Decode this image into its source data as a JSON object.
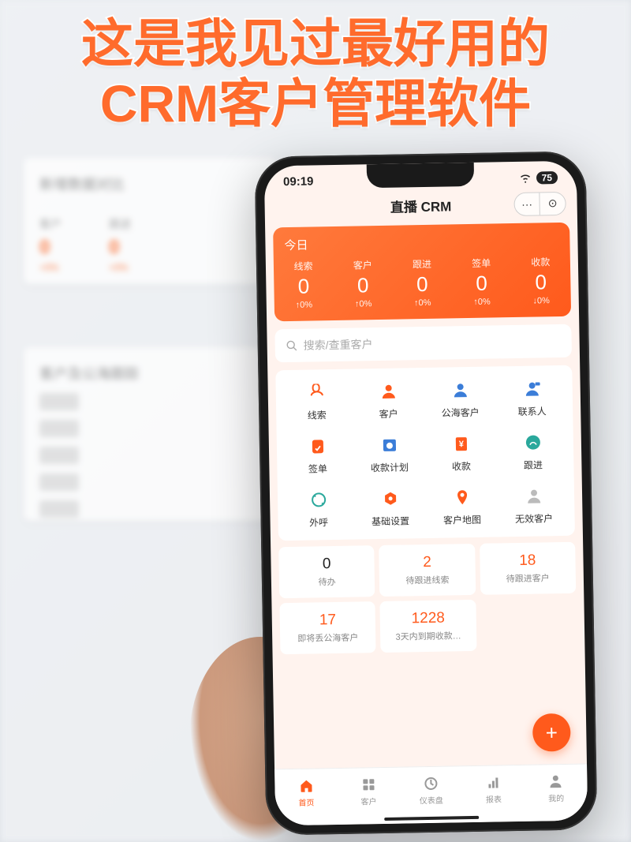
{
  "overlay": {
    "line1": "这是我见过最好用的",
    "line2": "CRM客户管理软件"
  },
  "bg": {
    "section1_title": "新增数据对比",
    "col1_label": "客户",
    "col2_label": "跟进",
    "val_zero": "0",
    "delta_zero": "+0%",
    "section2_title": "客户及公海跟踪"
  },
  "status": {
    "time": "09:19",
    "battery": "75"
  },
  "header": {
    "title": "直播 CRM",
    "more": "···",
    "target": "⊙"
  },
  "stats": {
    "today": "今日",
    "items": [
      {
        "label": "线索",
        "value": "0",
        "delta": "↑0%"
      },
      {
        "label": "客户",
        "value": "0",
        "delta": "↑0%"
      },
      {
        "label": "跟进",
        "value": "0",
        "delta": "↑0%"
      },
      {
        "label": "签单",
        "value": "0",
        "delta": "↑0%"
      },
      {
        "label": "收款",
        "value": "0",
        "delta": "↓0%"
      }
    ]
  },
  "search": {
    "placeholder": "搜索/查重客户"
  },
  "menu": [
    {
      "label": "线索",
      "color": "#ff5a1c"
    },
    {
      "label": "客户",
      "color": "#ff5a1c"
    },
    {
      "label": "公海客户",
      "color": "#3b7dd8"
    },
    {
      "label": "联系人",
      "color": "#3b7dd8"
    },
    {
      "label": "签单",
      "color": "#ff5a1c"
    },
    {
      "label": "收款计划",
      "color": "#3b7dd8"
    },
    {
      "label": "收款",
      "color": "#ff5a1c"
    },
    {
      "label": "跟进",
      "color": "#2aa89c"
    },
    {
      "label": "外呼",
      "color": "#2aa89c"
    },
    {
      "label": "基础设置",
      "color": "#ff5a1c"
    },
    {
      "label": "客户地图",
      "color": "#ff5a1c"
    },
    {
      "label": "无效客户",
      "color": "#999"
    }
  ],
  "counts": [
    {
      "value": "0",
      "label": "待办",
      "accent": false
    },
    {
      "value": "2",
      "label": "待跟进线索",
      "accent": true
    },
    {
      "value": "18",
      "label": "待跟进客户",
      "accent": true
    },
    {
      "value": "17",
      "label": "即将丢公海客户",
      "accent": true
    },
    {
      "value": "1228",
      "label": "3天内到期收款…",
      "accent": true
    }
  ],
  "fab": {
    "plus": "+"
  },
  "tabs": [
    {
      "label": "首页",
      "active": true
    },
    {
      "label": "客户",
      "active": false
    },
    {
      "label": "仪表盘",
      "active": false
    },
    {
      "label": "报表",
      "active": false
    },
    {
      "label": "我的",
      "active": false
    }
  ]
}
